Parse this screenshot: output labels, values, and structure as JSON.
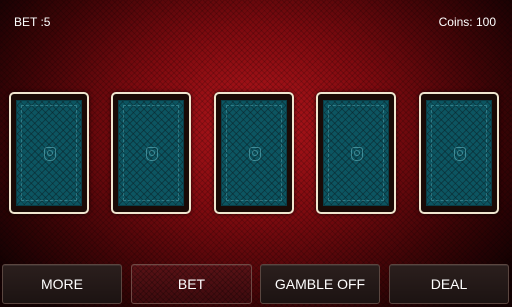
{
  "hud": {
    "bet_text": "BET :5",
    "coins_text": "Coins: 100"
  },
  "cards": [
    {
      "state": "face-down"
    },
    {
      "state": "face-down"
    },
    {
      "state": "face-down"
    },
    {
      "state": "face-down"
    },
    {
      "state": "face-down"
    }
  ],
  "buttons": {
    "more": "MORE",
    "bet": "BET",
    "gamble": "GAMBLE OFF",
    "deal": "DEAL"
  },
  "colors": {
    "table_red": "#7d0a0f",
    "card_back_teal": "#0c5561",
    "card_border": "#f0e6cf",
    "button_dark": "#241918",
    "button_active_red": "#4a0e11"
  }
}
